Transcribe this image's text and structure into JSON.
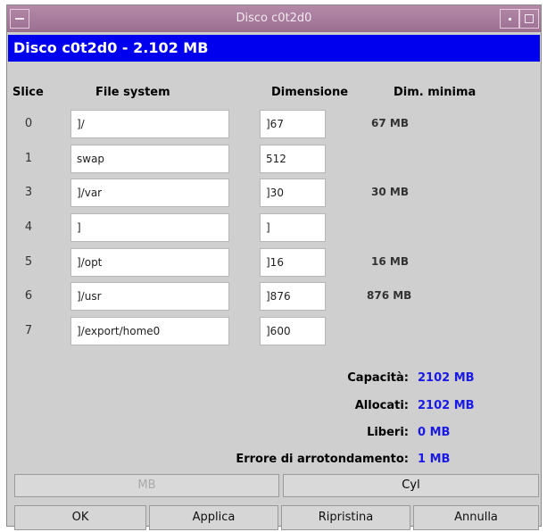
{
  "window": {
    "title": "Disco c0t2d0"
  },
  "header": {
    "text": "Disco c0t2d0 - 2.102 MB",
    "color": "#0000ee"
  },
  "columns": {
    "slice": "Slice",
    "file_system": "File system",
    "size": "Dimensione",
    "min_size": "Dim. minima"
  },
  "rows": [
    {
      "slice": "0",
      "file_system": "]/",
      "size": "]67",
      "min": "67 MB"
    },
    {
      "slice": "1",
      "file_system": "swap",
      "size": "512",
      "min": ""
    },
    {
      "slice": "3",
      "file_system": "]/var",
      "size": "]30",
      "min": "30 MB"
    },
    {
      "slice": "4",
      "file_system": "]",
      "size": "]",
      "min": ""
    },
    {
      "slice": "5",
      "file_system": "]/opt",
      "size": "]16",
      "min": "16 MB"
    },
    {
      "slice": "6",
      "file_system": "]/usr",
      "size": "]876",
      "min": "876 MB"
    },
    {
      "slice": "7",
      "file_system": "]/export/home0",
      "size": "]600",
      "min": ""
    }
  ],
  "summary": {
    "capacity_label": "Capacità:",
    "capacity_value": "2102 MB",
    "allocated_label": "Allocati:",
    "allocated_value": "2102 MB",
    "free_label": "Liberi:",
    "free_value": "0 MB",
    "rounding_label": "Errore di arrotondamento:",
    "rounding_value": "1 MB",
    "value_color": "#1a1ae6"
  },
  "units": {
    "mb": "MB",
    "cyl": "Cyl"
  },
  "actions": {
    "ok": "OK",
    "apply": "Applica",
    "reset": "Ripristina",
    "cancel": "Annulla"
  }
}
